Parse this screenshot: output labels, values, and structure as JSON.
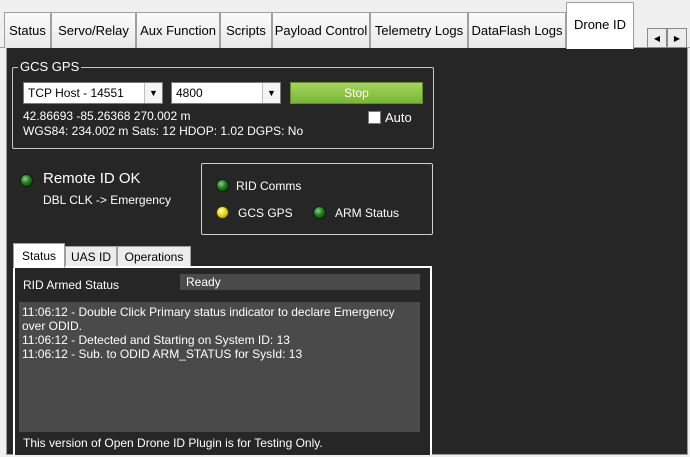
{
  "tabs": [
    {
      "label": "Status"
    },
    {
      "label": "Servo/Relay"
    },
    {
      "label": "Aux Function"
    },
    {
      "label": "Scripts"
    },
    {
      "label": "Payload Control"
    },
    {
      "label": "Telemetry Logs"
    },
    {
      "label": "DataFlash Logs"
    },
    {
      "label": "Drone ID"
    }
  ],
  "tab_scroll": {
    "left_icon": "◀",
    "right_icon": "▶"
  },
  "gcs_gps": {
    "title": "GCS GPS",
    "connection_value": "TCP Host - 14551",
    "baud_value": "4800",
    "stop_label": "Stop",
    "auto_label": "Auto",
    "coords_line": "42.86693  -85.26368  270.002  m",
    "wgs_line": "WGS84: 234.002 m Sats: 12 HDOP: 1.02 DGPS: No"
  },
  "remote_id": {
    "status_label": "Remote ID OK",
    "hint": "DBL CLK -> Emergency"
  },
  "indicators": {
    "rid_comms": "RID Comms",
    "gcs_gps": "GCS GPS",
    "arm_status": "ARM Status"
  },
  "inner_tabs": [
    {
      "label": "Status"
    },
    {
      "label": "UAS ID"
    },
    {
      "label": "Operations"
    }
  ],
  "status_panel": {
    "armed_label": "RID Armed Status",
    "armed_value": "Ready",
    "log": [
      "11:06:12 - Double Click Primary status indicator to declare Emergency",
      "over ODID.",
      "11:06:12 - Detected and Starting on System ID: 13",
      "11:06:12 - Sub. to ODID ARM_STATUS for SysId: 13"
    ],
    "footer": "This version of Open Drone ID Plugin is for Testing Only."
  },
  "colors": {
    "panel_bg": "#262626",
    "led_green": "#1e7d1e",
    "led_yellow": "#e6d81c",
    "stop_button": "#8cc44a"
  }
}
